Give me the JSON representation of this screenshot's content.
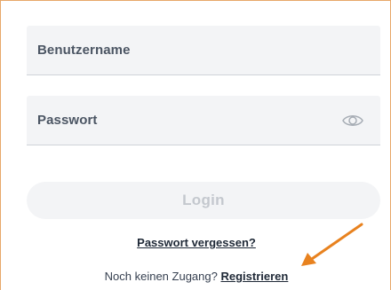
{
  "login_form": {
    "username_placeholder": "Benutzername",
    "password_placeholder": "Passwort",
    "login_label": "Login",
    "forgot_password_label": "Passwort vergessen?",
    "no_account_text": "Noch keinen Zugang?",
    "register_label": "Registrieren"
  },
  "icons": {
    "password_toggle": "eye-icon",
    "annotation": "arrow-icon"
  },
  "colors": {
    "frame_border": "#e7a869",
    "field_bg": "#f3f4f6",
    "button_disabled_text": "#c4c8ce",
    "arrow": "#e8821f"
  }
}
